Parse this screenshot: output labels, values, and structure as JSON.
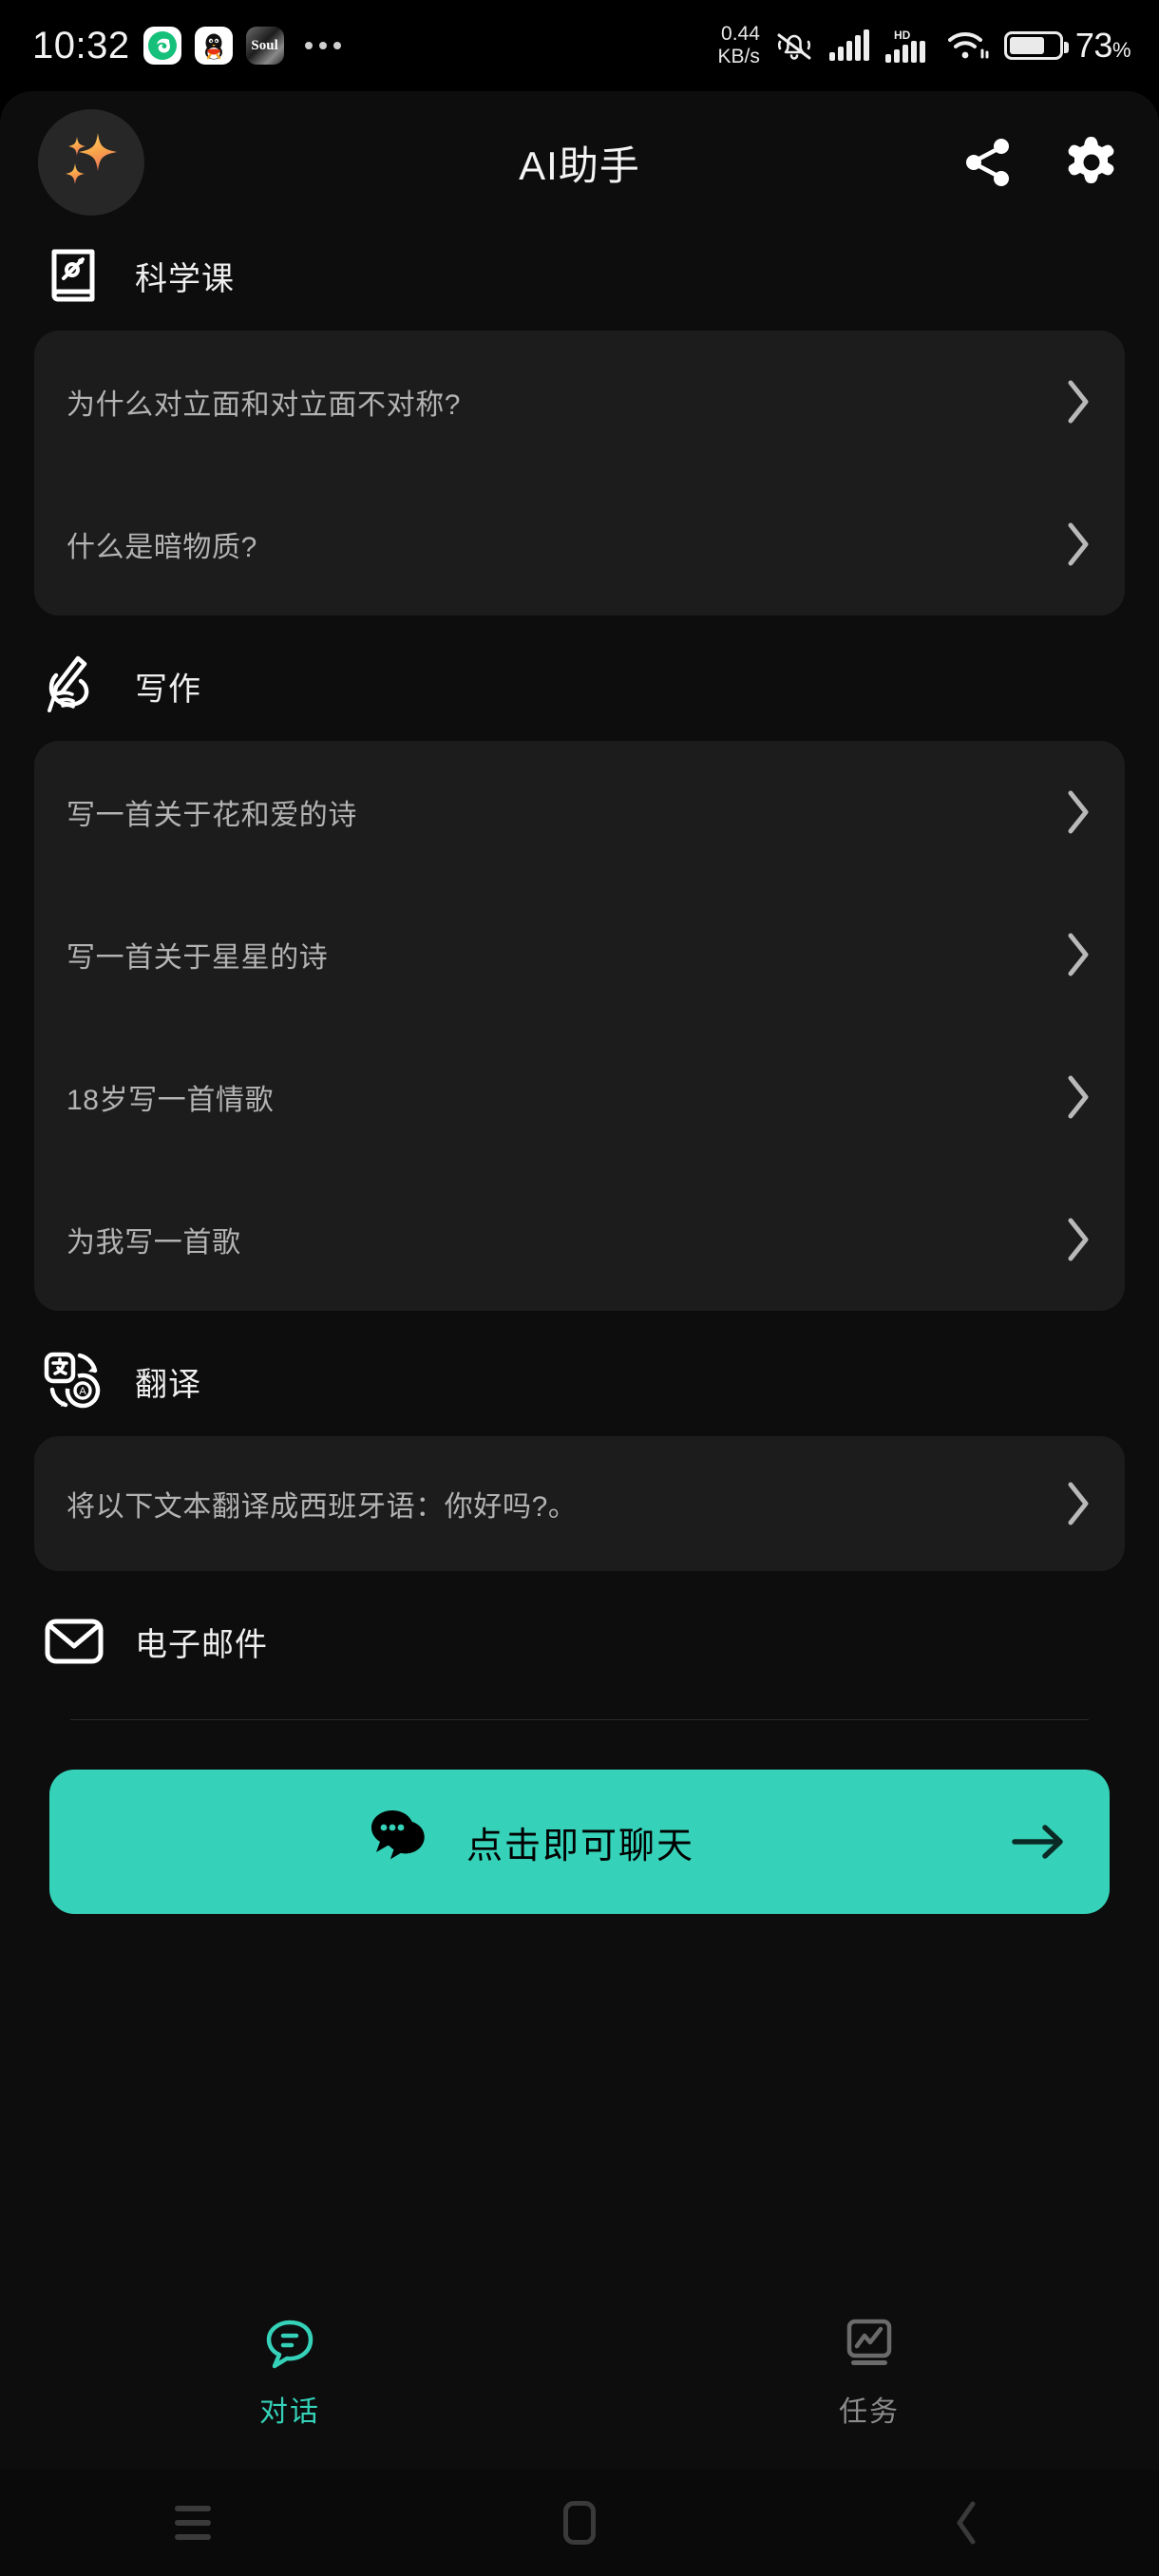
{
  "status_bar": {
    "time": "10:32",
    "app_icons": [
      "green-swirl-app-icon",
      "qq-penguin-app-icon",
      "soul-app-icon"
    ],
    "soul_label": "Soul",
    "overflow_dots": "•••",
    "network_speed_value": "0.44",
    "network_speed_unit": "KB/s",
    "mute_icon": "bell-muted-icon",
    "signal_one": "signal-bars-icon",
    "hd_label": "HD",
    "signal_two": "signal-bars-icon",
    "wifi_icon": "wifi-icon",
    "battery_icon": "battery-icon",
    "battery_percent": "73",
    "battery_percent_symbol": "%"
  },
  "header": {
    "title": "AI助手",
    "avatar_icon": "sparkles-avatar-icon",
    "share_icon": "share-icon",
    "settings_icon": "gear-icon"
  },
  "colors": {
    "accent": "#35d1b8",
    "page_bg": "#0d0d0d",
    "card_bg": "#1c1c1c",
    "secondary_text": "#b3b3b3",
    "avatar_gradient_start": "#ffd46a",
    "avatar_gradient_end": "#f58a55"
  },
  "sections": [
    {
      "id": "science",
      "label": "科学课",
      "icon": "science-book-icon",
      "items": [
        {
          "text": "为什么对立面和对立面不对称?"
        },
        {
          "text": "什么是暗物质?"
        }
      ]
    },
    {
      "id": "writing",
      "label": "写作",
      "icon": "hand-writing-icon",
      "items": [
        {
          "text": "写一首关于花和爱的诗"
        },
        {
          "text": "写一首关于星星的诗"
        },
        {
          "text": "18岁写一首情歌"
        },
        {
          "text": "为我写一首歌"
        }
      ]
    },
    {
      "id": "translate",
      "label": "翻译",
      "icon": "translate-icon",
      "items": [
        {
          "text": "将以下文本翻译成西班牙语：你好吗?。"
        }
      ]
    },
    {
      "id": "email",
      "label": "电子邮件",
      "icon": "envelope-icon",
      "items": []
    }
  ],
  "cta": {
    "label": "点击即可聊天",
    "chat_icon": "chat-bubbles-icon",
    "arrow_icon": "arrow-right-icon"
  },
  "bottom_tabs": [
    {
      "label": "对话",
      "icon": "chat-bubble-lines-icon",
      "active": true
    },
    {
      "label": "任务",
      "icon": "task-chart-icon",
      "active": false
    }
  ],
  "android_nav": {
    "recents": "recents-lines-icon",
    "home": "home-square-icon",
    "back": "back-chevron-icon"
  }
}
